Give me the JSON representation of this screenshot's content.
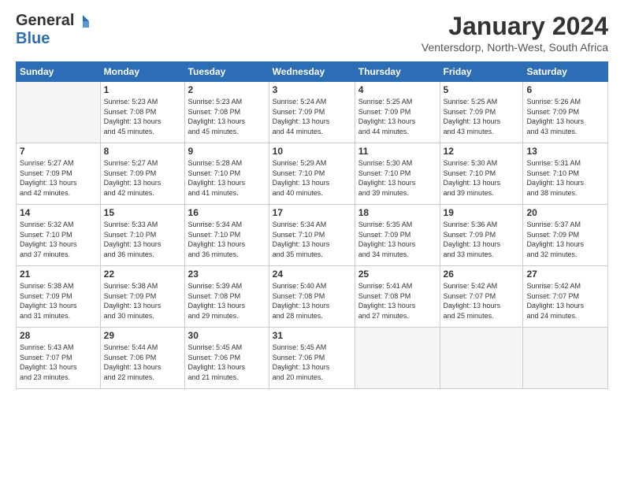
{
  "logo": {
    "general": "General",
    "blue": "Blue"
  },
  "title": "January 2024",
  "location": "Ventersdorp, North-West, South Africa",
  "days_header": [
    "Sunday",
    "Monday",
    "Tuesday",
    "Wednesday",
    "Thursday",
    "Friday",
    "Saturday"
  ],
  "weeks": [
    [
      {
        "num": "",
        "info": ""
      },
      {
        "num": "1",
        "info": "Sunrise: 5:23 AM\nSunset: 7:08 PM\nDaylight: 13 hours\nand 45 minutes."
      },
      {
        "num": "2",
        "info": "Sunrise: 5:23 AM\nSunset: 7:08 PM\nDaylight: 13 hours\nand 45 minutes."
      },
      {
        "num": "3",
        "info": "Sunrise: 5:24 AM\nSunset: 7:09 PM\nDaylight: 13 hours\nand 44 minutes."
      },
      {
        "num": "4",
        "info": "Sunrise: 5:25 AM\nSunset: 7:09 PM\nDaylight: 13 hours\nand 44 minutes."
      },
      {
        "num": "5",
        "info": "Sunrise: 5:25 AM\nSunset: 7:09 PM\nDaylight: 13 hours\nand 43 minutes."
      },
      {
        "num": "6",
        "info": "Sunrise: 5:26 AM\nSunset: 7:09 PM\nDaylight: 13 hours\nand 43 minutes."
      }
    ],
    [
      {
        "num": "7",
        "info": "Sunrise: 5:27 AM\nSunset: 7:09 PM\nDaylight: 13 hours\nand 42 minutes."
      },
      {
        "num": "8",
        "info": "Sunrise: 5:27 AM\nSunset: 7:09 PM\nDaylight: 13 hours\nand 42 minutes."
      },
      {
        "num": "9",
        "info": "Sunrise: 5:28 AM\nSunset: 7:10 PM\nDaylight: 13 hours\nand 41 minutes."
      },
      {
        "num": "10",
        "info": "Sunrise: 5:29 AM\nSunset: 7:10 PM\nDaylight: 13 hours\nand 40 minutes."
      },
      {
        "num": "11",
        "info": "Sunrise: 5:30 AM\nSunset: 7:10 PM\nDaylight: 13 hours\nand 39 minutes."
      },
      {
        "num": "12",
        "info": "Sunrise: 5:30 AM\nSunset: 7:10 PM\nDaylight: 13 hours\nand 39 minutes."
      },
      {
        "num": "13",
        "info": "Sunrise: 5:31 AM\nSunset: 7:10 PM\nDaylight: 13 hours\nand 38 minutes."
      }
    ],
    [
      {
        "num": "14",
        "info": "Sunrise: 5:32 AM\nSunset: 7:10 PM\nDaylight: 13 hours\nand 37 minutes."
      },
      {
        "num": "15",
        "info": "Sunrise: 5:33 AM\nSunset: 7:10 PM\nDaylight: 13 hours\nand 36 minutes."
      },
      {
        "num": "16",
        "info": "Sunrise: 5:34 AM\nSunset: 7:10 PM\nDaylight: 13 hours\nand 36 minutes."
      },
      {
        "num": "17",
        "info": "Sunrise: 5:34 AM\nSunset: 7:10 PM\nDaylight: 13 hours\nand 35 minutes."
      },
      {
        "num": "18",
        "info": "Sunrise: 5:35 AM\nSunset: 7:09 PM\nDaylight: 13 hours\nand 34 minutes."
      },
      {
        "num": "19",
        "info": "Sunrise: 5:36 AM\nSunset: 7:09 PM\nDaylight: 13 hours\nand 33 minutes."
      },
      {
        "num": "20",
        "info": "Sunrise: 5:37 AM\nSunset: 7:09 PM\nDaylight: 13 hours\nand 32 minutes."
      }
    ],
    [
      {
        "num": "21",
        "info": "Sunrise: 5:38 AM\nSunset: 7:09 PM\nDaylight: 13 hours\nand 31 minutes."
      },
      {
        "num": "22",
        "info": "Sunrise: 5:38 AM\nSunset: 7:09 PM\nDaylight: 13 hours\nand 30 minutes."
      },
      {
        "num": "23",
        "info": "Sunrise: 5:39 AM\nSunset: 7:08 PM\nDaylight: 13 hours\nand 29 minutes."
      },
      {
        "num": "24",
        "info": "Sunrise: 5:40 AM\nSunset: 7:08 PM\nDaylight: 13 hours\nand 28 minutes."
      },
      {
        "num": "25",
        "info": "Sunrise: 5:41 AM\nSunset: 7:08 PM\nDaylight: 13 hours\nand 27 minutes."
      },
      {
        "num": "26",
        "info": "Sunrise: 5:42 AM\nSunset: 7:07 PM\nDaylight: 13 hours\nand 25 minutes."
      },
      {
        "num": "27",
        "info": "Sunrise: 5:42 AM\nSunset: 7:07 PM\nDaylight: 13 hours\nand 24 minutes."
      }
    ],
    [
      {
        "num": "28",
        "info": "Sunrise: 5:43 AM\nSunset: 7:07 PM\nDaylight: 13 hours\nand 23 minutes."
      },
      {
        "num": "29",
        "info": "Sunrise: 5:44 AM\nSunset: 7:06 PM\nDaylight: 13 hours\nand 22 minutes."
      },
      {
        "num": "30",
        "info": "Sunrise: 5:45 AM\nSunset: 7:06 PM\nDaylight: 13 hours\nand 21 minutes."
      },
      {
        "num": "31",
        "info": "Sunrise: 5:45 AM\nSunset: 7:06 PM\nDaylight: 13 hours\nand 20 minutes."
      },
      {
        "num": "",
        "info": ""
      },
      {
        "num": "",
        "info": ""
      },
      {
        "num": "",
        "info": ""
      }
    ]
  ]
}
